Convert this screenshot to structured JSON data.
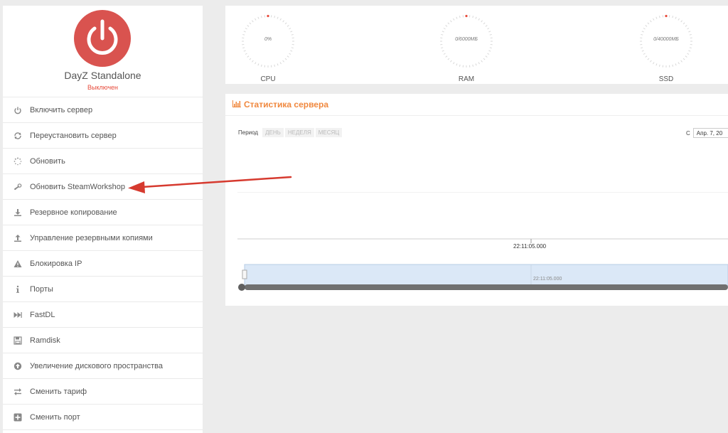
{
  "profile": {
    "game_name": "DayZ Standalone",
    "status": "Выключен"
  },
  "menu": [
    {
      "label": "Включить сервер",
      "icon": "power-icon"
    },
    {
      "label": "Переустановить сервер",
      "icon": "refresh-icon"
    },
    {
      "label": "Обновить",
      "icon": "spinner-icon"
    },
    {
      "label": "Обновить SteamWorkshop",
      "icon": "steam-icon"
    },
    {
      "label": "Резервное копирование",
      "icon": "download-icon"
    },
    {
      "label": "Управление резервными копиями",
      "icon": "upload-icon"
    },
    {
      "label": "Блокировка IP",
      "icon": "warning-icon"
    },
    {
      "label": "Порты",
      "icon": "info-icon"
    },
    {
      "label": "FastDL",
      "icon": "fast-forward-icon"
    },
    {
      "label": "Ramdisk",
      "icon": "floppy-icon"
    },
    {
      "label": "Увеличение дискового пространства",
      "icon": "arrow-up-circle-icon"
    },
    {
      "label": "Сменить тариф",
      "icon": "exchange-icon"
    },
    {
      "label": "Сменить порт",
      "icon": "plus-square-icon"
    }
  ],
  "gauges": [
    {
      "label": "CPU",
      "value": "0%"
    },
    {
      "label": "RAM",
      "value": "0/6000МБ"
    },
    {
      "label": "SSD",
      "value": "0/40000МБ"
    }
  ],
  "stats": {
    "title": "Статистика сервера",
    "period_label": "Период",
    "periods": [
      "ДЕНЬ",
      "НЕДЕЛЯ",
      "МЕСЯЦ"
    ],
    "date_label": "С",
    "date_value": "Апр. 7, 20",
    "time_main": "22:11:05.000",
    "time_nav": "22:11:05.000"
  },
  "colors": {
    "accent": "#f0883e",
    "power": "#d9534f",
    "status": "#e74c3c",
    "annotation_arrow": "#d63a2f"
  }
}
